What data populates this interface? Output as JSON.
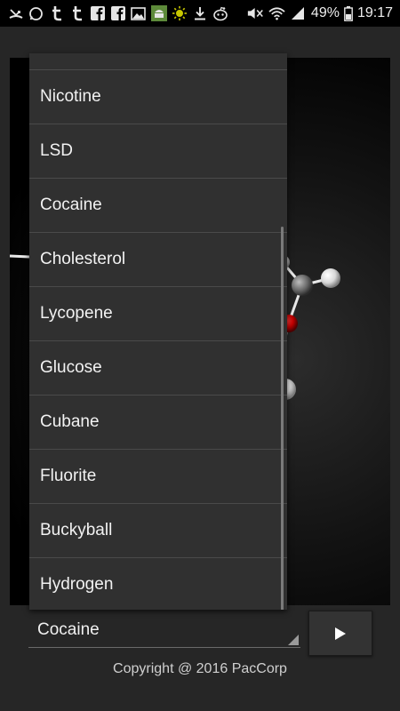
{
  "status_bar": {
    "icons": [
      "missed-call-icon",
      "whatsapp-icon",
      "tumblr-icon",
      "tumblr-icon",
      "facebook-icon",
      "facebook-icon",
      "gallery-icon",
      "android-icon",
      "brightness-icon",
      "download-icon",
      "reddit-icon"
    ],
    "right_icons": [
      "mute-icon",
      "wifi-icon",
      "signal-icon",
      "battery-icon"
    ],
    "battery": "49%",
    "time": "19:17"
  },
  "dropdown": {
    "items": [
      "Nicotine",
      "LSD",
      "Cocaine",
      "Cholesterol",
      "Lycopene",
      "Glucose",
      "Cubane",
      "Fluorite",
      "Buckyball",
      "Hydrogen"
    ]
  },
  "spinner": {
    "selected": "Cocaine"
  },
  "footer": {
    "copyright": "Copyright @ 2016 PacCorp"
  },
  "colors": {
    "background": "#262626",
    "dropdown_bg": "#303030",
    "atom_white": "#e8e8e8",
    "atom_gray": "#7a7a7a",
    "atom_red": "#c00000"
  }
}
